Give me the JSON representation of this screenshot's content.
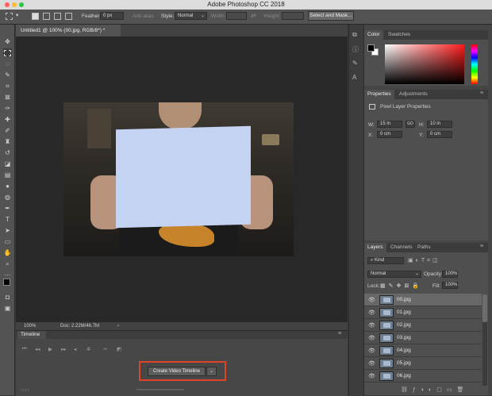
{
  "title": "Adobe Photoshop CC 2018",
  "options_bar": {
    "feather_label": "Feather:",
    "feather_value": "0 px",
    "antialias_label": "Anti-alias",
    "style_label": "Style:",
    "style_value": "Normal",
    "width_label": "Width:",
    "height_label": "Height:",
    "select_mask_label": "Select and Mask..."
  },
  "document": {
    "tab_title": "Untitled1 @ 100% (00.jpg, RGB/8*) *",
    "zoom": "100%",
    "doc_info": "Doc: 2.22M/46.7M"
  },
  "timeline": {
    "tab_label": "Timeline",
    "create_button": "Create Video Timeline"
  },
  "color_panel": {
    "tabs": [
      "Color",
      "Swatches"
    ]
  },
  "properties_panel": {
    "tabs": [
      "Properties",
      "Adjustments"
    ],
    "heading": "Pixel Layer Properties",
    "w_label": "W:",
    "w_value": "15 in",
    "link_label": "GO",
    "h_label": "H:",
    "h_value": "10 in",
    "x_label": "X:",
    "x_value": "0 cm",
    "y_label": "Y:",
    "y_value": "0 cm"
  },
  "layers_panel": {
    "tabs": [
      "Layers",
      "Channels",
      "Paths"
    ],
    "filter_label": "Kind",
    "blend_mode": "Normal",
    "opacity_label": "Opacity:",
    "opacity_value": "100%",
    "lock_label": "Lock:",
    "fill_label": "Fill:",
    "fill_value": "100%",
    "layers": [
      "00.jpg",
      "01.jpg",
      "02.jpg",
      "03.jpg",
      "04.jpg",
      "05.jpg",
      "06.jpg"
    ]
  },
  "colors": {
    "highlight_border": "#e0432a",
    "panel_bg": "#4f4f4f",
    "canvas_bg": "#282828"
  }
}
